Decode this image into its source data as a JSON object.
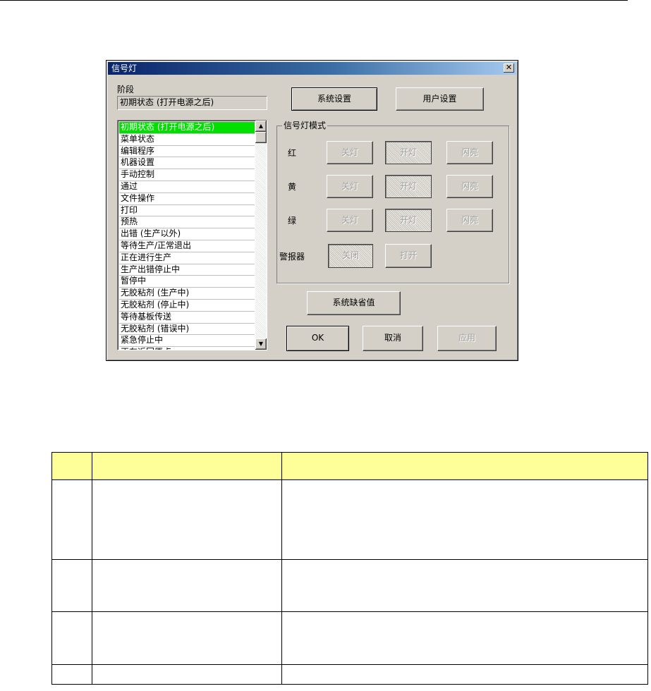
{
  "dialog": {
    "title": "信号灯",
    "close_glyph": "✕",
    "phase_label": "阶段",
    "phase_value": "初期状态 (打开电源之后)",
    "list_items": [
      "初期状态 (打开电源之后)",
      "菜单状态",
      "编辑程序",
      "机器设置",
      "手动控制",
      "通过",
      "文件操作",
      "打印",
      "预热",
      "出错 (生产以外)",
      "等待生产/正常退出",
      "正在进行生产",
      "生产出错停止中",
      "暂停中",
      "无胶粘剂 (生产中)",
      "无胶粘剂 (停止中)",
      "等待基板传送",
      "无胶粘剂 (错误中)",
      "紧急停止中",
      "正在返回原点"
    ],
    "selected_index": 0,
    "system_settings_label": "系统设置",
    "user_settings_label": "用户设置",
    "mode_group_title": "信号灯模式",
    "rows": [
      {
        "label": "红",
        "off": "关灯",
        "on": "开灯",
        "blink": "闪亮"
      },
      {
        "label": "黄",
        "off": "关灯",
        "on": "开灯",
        "blink": "闪亮"
      },
      {
        "label": "绿",
        "off": "关灯",
        "on": "开灯",
        "blink": "闪亮"
      }
    ],
    "buzzer": {
      "label": "警报器",
      "off": "关闭",
      "on": "打开"
    },
    "system_default_label": "系统缺省值",
    "ok_label": "OK",
    "cancel_label": "取消",
    "apply_label": "应用"
  },
  "colors": {
    "selection": "#00e000",
    "title_start": "#0a246a",
    "title_end": "#a6caf0",
    "table_header": "#ffff99"
  }
}
